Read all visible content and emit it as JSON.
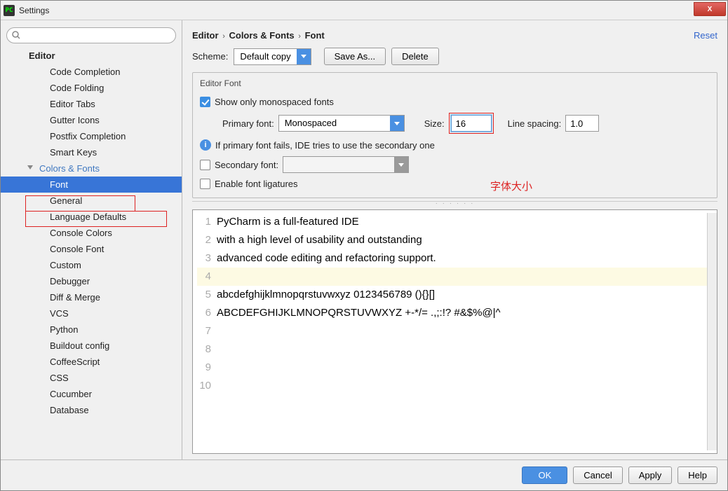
{
  "window": {
    "title": "Settings",
    "icon_text": "PC"
  },
  "close_label": "X",
  "search": {
    "placeholder": ""
  },
  "sidebar": {
    "root": "Editor",
    "items": [
      "Code Completion",
      "Code Folding",
      "Editor Tabs",
      "Gutter Icons",
      "Postfix Completion",
      "Smart Keys"
    ],
    "section_label": "Colors & Fonts",
    "sub_items": [
      "Font",
      "General",
      "Language Defaults",
      "Console Colors",
      "Console Font",
      "Custom",
      "Debugger",
      "Diff & Merge",
      "VCS",
      "Python",
      "Buildout config",
      "CoffeeScript",
      "CSS",
      "Cucumber",
      "Database"
    ],
    "selected_sub_index": 0
  },
  "breadcrumbs": {
    "p0": "Editor",
    "p1": "Colors & Fonts",
    "p2": "Font",
    "sep": "›"
  },
  "reset": "Reset",
  "scheme": {
    "label": "Scheme:",
    "value": "Default copy",
    "save_as": "Save As...",
    "delete": "Delete"
  },
  "editor_font": {
    "legend": "Editor Font",
    "mono_label": "Show only monospaced fonts",
    "primary_label": "Primary font:",
    "primary_value": "Monospaced",
    "size_label": "Size:",
    "size_value": "16",
    "line_spacing_label": "Line spacing:",
    "line_spacing_value": "1.0",
    "info_text": "If primary font fails, IDE tries to use the secondary one",
    "secondary_label": "Secondary font:",
    "secondary_value": "",
    "ligatures_label": "Enable font ligatures"
  },
  "annotation": "字体大小",
  "preview": {
    "lines": [
      "PyCharm is a full-featured IDE",
      "with a high level of usability and outstanding",
      "advanced code editing and refactoring support.",
      "",
      "abcdefghijklmnopqrstuvwxyz 0123456789 (){}[]",
      "ABCDEFGHIJKLMNOPQRSTUVWXYZ +-*/= .,;:!? #&$%@|^",
      "",
      "",
      "",
      ""
    ],
    "highlight_line": 3
  },
  "footer": {
    "ok": "OK",
    "cancel": "Cancel",
    "apply": "Apply",
    "help": "Help"
  }
}
